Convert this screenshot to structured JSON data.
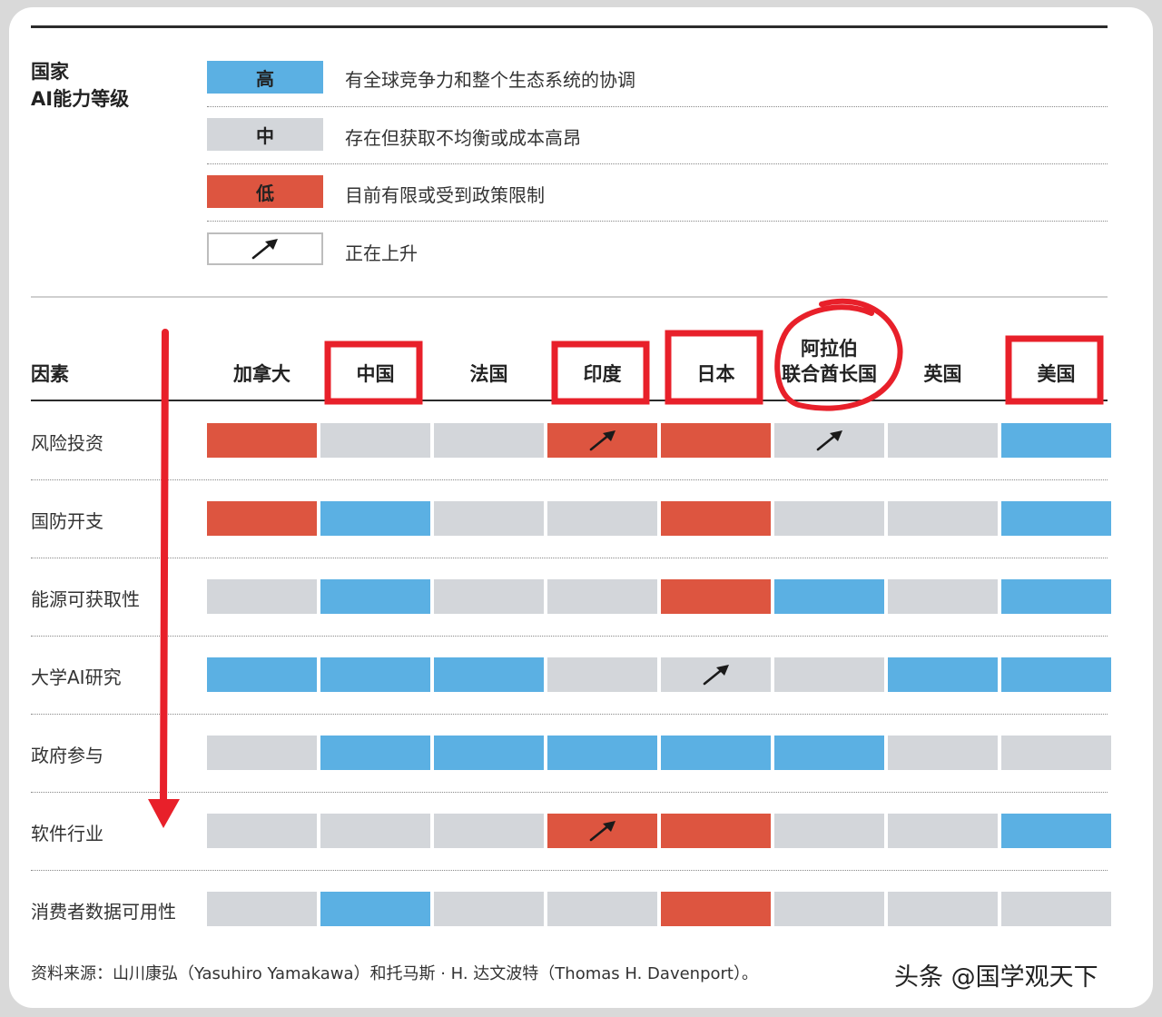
{
  "legend": {
    "title_line1": "国家",
    "title_line2": "AI能力等级",
    "items": [
      {
        "label": "高",
        "description": "有全球竞争力和整个生态系统的协调",
        "color": "#5bb0e3"
      },
      {
        "label": "中",
        "description": "存在但获取不均衡或成本高昂",
        "color": "#d3d6da"
      },
      {
        "label": "低",
        "description": "目前有限或受到政策限制",
        "color": "#dd5540"
      },
      {
        "label": "",
        "description": "正在上升",
        "icon": "up-right-arrow-icon"
      }
    ]
  },
  "chart_data": {
    "type": "table",
    "row_header": "因素",
    "countries": [
      {
        "name": "加拿大"
      },
      {
        "name": "中国"
      },
      {
        "name": "法国"
      },
      {
        "name": "印度"
      },
      {
        "name": "日本"
      },
      {
        "name": "阿拉伯",
        "name2": "联合酋长国"
      },
      {
        "name": "英国"
      },
      {
        "name": "美国"
      }
    ],
    "levels": {
      "high": "#5bb0e3",
      "medium": "#d3d6da",
      "low": "#dd5540"
    },
    "factors": [
      {
        "name": "风险投资",
        "ratings": [
          "low",
          "medium",
          "medium",
          "low",
          "low",
          "medium",
          "medium",
          "high"
        ],
        "rising": [
          3,
          5
        ]
      },
      {
        "name": "国防开支",
        "ratings": [
          "low",
          "high",
          "medium",
          "medium",
          "low",
          "medium",
          "medium",
          "high"
        ],
        "rising": []
      },
      {
        "name": "能源可获取性",
        "ratings": [
          "medium",
          "high",
          "medium",
          "medium",
          "low",
          "high",
          "medium",
          "high"
        ],
        "rising": []
      },
      {
        "name": "大学AI研究",
        "ratings": [
          "high",
          "high",
          "high",
          "medium",
          "medium",
          "medium",
          "high",
          "high"
        ],
        "rising": [
          4
        ]
      },
      {
        "name": "政府参与",
        "ratings": [
          "medium",
          "high",
          "high",
          "high",
          "high",
          "high",
          "medium",
          "medium"
        ],
        "rising": []
      },
      {
        "name": "软件行业",
        "ratings": [
          "medium",
          "medium",
          "medium",
          "low",
          "low",
          "medium",
          "medium",
          "high"
        ],
        "rising": [
          3
        ]
      },
      {
        "name": "消费者数据可用性",
        "ratings": [
          "medium",
          "high",
          "medium",
          "medium",
          "low",
          "medium",
          "medium",
          "medium"
        ],
        "rising": []
      }
    ],
    "annotations": {
      "highlighted_countries": [
        1,
        3,
        4,
        5,
        7
      ],
      "color": "#e8202a"
    }
  },
  "source": "资料来源：山川康弘（Yasuhiro Yamakawa）和托马斯 · H. 达文波特（Thomas H. Davenport）。",
  "watermark": "头条 @国学观天下"
}
